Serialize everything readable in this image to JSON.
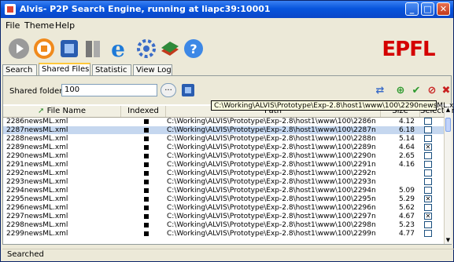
{
  "window": {
    "title": "Alvis- P2P Search Engine, running at liapc39:10001",
    "minimize": "_",
    "maximize": "□",
    "close": "✕"
  },
  "menu": [
    "File",
    "Theme",
    "Help"
  ],
  "logo": "EPFL",
  "tabs": [
    {
      "label": "Search",
      "active": false
    },
    {
      "label": "Shared Files",
      "active": true
    },
    {
      "label": "Statistic",
      "active": false
    },
    {
      "label": "View Log",
      "active": false
    }
  ],
  "shared_folder": {
    "label": "Shared folder",
    "value": "100",
    "browse_label": "..."
  },
  "table": {
    "headers": {
      "name": "File Name",
      "indexed": "Indexed",
      "path": "Path",
      "size": "Size",
      "selection": "Selection"
    },
    "rows": [
      {
        "name": "2286newsML.xml",
        "path": "C:\\Working\\ALVIS\\Prototype\\Exp-2.8\\host1\\www\\100\\2286news...",
        "size": "4.12",
        "selected": false,
        "checked": false
      },
      {
        "name": "2287newsML.xml",
        "path": "C:\\Working\\ALVIS\\Prototype\\Exp-2.8\\host1\\www\\100\\2287news...",
        "size": "6.18",
        "selected": true,
        "checked": false
      },
      {
        "name": "2288newsML.xml",
        "path": "C:\\Working\\ALVIS\\Prototype\\Exp-2.8\\host1\\www\\100\\2288news...",
        "size": "5.14",
        "selected": false,
        "checked": false
      },
      {
        "name": "2289newsML.xml",
        "path": "C:\\Working\\ALVIS\\Prototype\\Exp-2.8\\host1\\www\\100\\2289news...",
        "size": "4.64",
        "selected": false,
        "checked": true
      },
      {
        "name": "2290newsML.xml",
        "path": "C:\\Working\\ALVIS\\Prototype\\Exp-2.8\\host1\\www\\100\\2290news...",
        "size": "2.65",
        "selected": false,
        "checked": false
      },
      {
        "name": "2291newsML.xml",
        "path": "C:\\Working\\ALVIS\\Prototype\\Exp-2.8\\host1\\www\\100\\2291news...",
        "size": "4.16",
        "selected": false,
        "checked": false
      },
      {
        "name": "2292newsML.xml",
        "path": "C:\\Working\\ALVIS\\Prototype\\Exp-2.8\\host1\\www\\100\\2292news...",
        "size": "",
        "selected": false,
        "checked": false
      },
      {
        "name": "2293newsML.xml",
        "path": "C:\\Working\\ALVIS\\Prototype\\Exp-2.8\\host1\\www\\100\\2293news...",
        "size": "",
        "selected": false,
        "checked": false
      },
      {
        "name": "2294newsML.xml",
        "path": "C:\\Working\\ALVIS\\Prototype\\Exp-2.8\\host1\\www\\100\\2294news...",
        "size": "5.09",
        "selected": false,
        "checked": false
      },
      {
        "name": "2295newsML.xml",
        "path": "C:\\Working\\ALVIS\\Prototype\\Exp-2.8\\host1\\www\\100\\2295news...",
        "size": "5.29",
        "selected": false,
        "checked": true
      },
      {
        "name": "2296newsML.xml",
        "path": "C:\\Working\\ALVIS\\Prototype\\Exp-2.8\\host1\\www\\100\\2296news...",
        "size": "5.62",
        "selected": false,
        "checked": false
      },
      {
        "name": "2297newsML.xml",
        "path": "C:\\Working\\ALVIS\\Prototype\\Exp-2.8\\host1\\www\\100\\2297news...",
        "size": "4.67",
        "selected": false,
        "checked": true
      },
      {
        "name": "2298newsML.xml",
        "path": "C:\\Working\\ALVIS\\Prototype\\Exp-2.8\\host1\\www\\100\\2298news...",
        "size": "5.23",
        "selected": false,
        "checked": false
      },
      {
        "name": "2299newsML.xml",
        "path": "C:\\Working\\ALVIS\\Prototype\\Exp-2.8\\host1\\www\\100\\2299news...",
        "size": "4.77",
        "selected": false,
        "checked": false
      }
    ]
  },
  "tooltip": "C:\\Working\\ALVIS\\Prototype\\Exp-2.8\\host1\\www\\100\\2290newsML.xml",
  "status": "Searched",
  "colors": {
    "title_bar": "#0855dd",
    "selection": "#c5d7ef",
    "logo_red": "#d40000"
  }
}
